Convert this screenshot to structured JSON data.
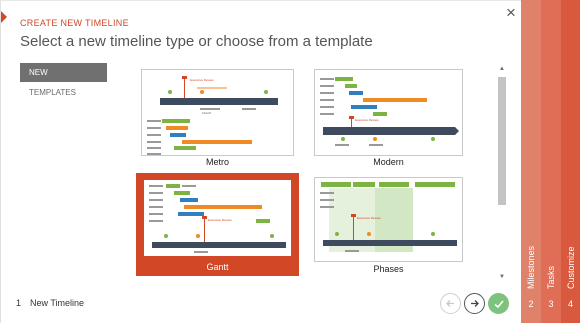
{
  "header": {
    "kicker": "CREATE NEW TIMELINE",
    "title": "Select a new timeline type or choose from a template"
  },
  "sidebar": {
    "items": [
      {
        "label": "NEW",
        "selected": true
      },
      {
        "label": "TEMPLATES",
        "selected": false
      }
    ]
  },
  "templates": [
    {
      "label": "Metro",
      "selected": false
    },
    {
      "label": "Modern",
      "selected": false
    },
    {
      "label": "Gantt",
      "selected": true
    },
    {
      "label": "Phases",
      "selected": false
    }
  ],
  "thumb_text": {
    "metro": {
      "milestone": "Executive Review",
      "sub": "Kickoff"
    },
    "modern": {
      "milestone": "Executive Review"
    },
    "gantt": {
      "milestone": "Executive Review"
    },
    "phases": {
      "milestone": "Executive Review"
    }
  },
  "footer": {
    "step_number": "1",
    "step_label": "New Timeline"
  },
  "steps": [
    {
      "label": "Milestones",
      "number": "2"
    },
    {
      "label": "Tasks",
      "number": "3"
    },
    {
      "label": "Customize",
      "number": "4"
    }
  ],
  "colors": {
    "accent": "#d24726",
    "timeline_bar": "#3e4a5e",
    "task_green": "#7cb342",
    "task_orange": "#f08a24",
    "task_blue": "#2f7fc1",
    "done_button": "#7dc37d"
  },
  "icons": {
    "close": "close-icon",
    "prev": "arrow-left-icon",
    "next": "arrow-right-icon",
    "done": "checkmark-icon"
  }
}
